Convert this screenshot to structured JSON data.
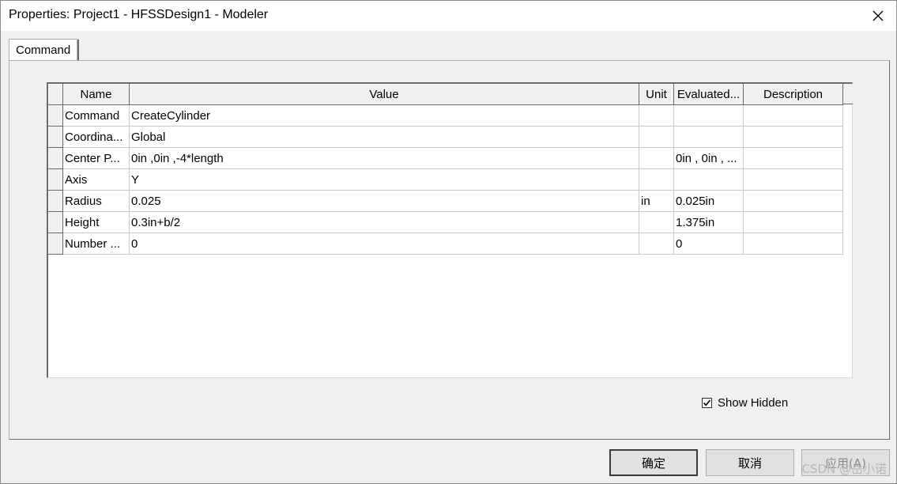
{
  "window": {
    "title": "Properties: Project1 - HFSSDesign1 - Modeler"
  },
  "tabs": [
    {
      "label": "Command"
    }
  ],
  "grid": {
    "columns": [
      "Name",
      "Value",
      "Unit",
      "Evaluated...",
      "Description"
    ],
    "rows": [
      {
        "name": "Command",
        "value": "CreateCylinder",
        "unit": "",
        "evaluated": "",
        "description": ""
      },
      {
        "name": "Coordina...",
        "value": "Global",
        "unit": "",
        "evaluated": "",
        "description": ""
      },
      {
        "name": "Center P...",
        "value": "0in ,0in ,-4*length",
        "unit": "",
        "evaluated": "0in , 0in , ...",
        "description": ""
      },
      {
        "name": "Axis",
        "value": "Y",
        "unit": "",
        "evaluated": "",
        "description": ""
      },
      {
        "name": "Radius",
        "value": "0.025",
        "unit": "in",
        "evaluated": "0.025in",
        "description": ""
      },
      {
        "name": "Height",
        "value": "0.3in+b/2",
        "unit": "",
        "evaluated": "1.375in",
        "description": ""
      },
      {
        "name": "Number ...",
        "value": "0",
        "unit": "",
        "evaluated": "0",
        "description": ""
      }
    ]
  },
  "show_hidden": {
    "label": "Show Hidden",
    "checked": true
  },
  "buttons": {
    "ok": "确定",
    "cancel": "取消",
    "apply": "应用(A)"
  },
  "watermark": "CSDN @岳小诺"
}
